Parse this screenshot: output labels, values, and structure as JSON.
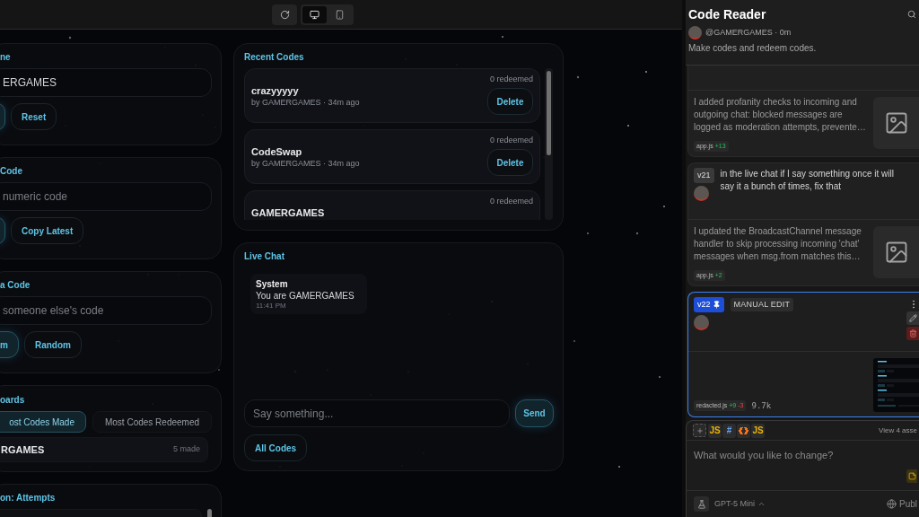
{
  "toolbar": {
    "devices": [
      {
        "kind": "desktop",
        "selected": true
      },
      {
        "kind": "mobile",
        "selected": false
      }
    ]
  },
  "left_cards": [
    {
      "kind": "form",
      "title": "ne",
      "field": {
        "value": "ERGAMES"
      },
      "buttons": [
        {
          "kind": "primary"
        },
        {
          "label": "Reset",
          "kind": "secondary"
        }
      ]
    },
    {
      "kind": "form",
      "title": "Code",
      "field": {
        "placeholder": "numeric code"
      },
      "buttons": [
        {
          "kind": "primary"
        },
        {
          "label": "Copy Latest",
          "kind": "secondary"
        }
      ]
    },
    {
      "kind": "form",
      "title": "a Code",
      "field": {
        "placeholder": "someone else's code"
      },
      "buttons": [
        {
          "label": "m",
          "kind": "primary"
        },
        {
          "label": "Random",
          "kind": "secondary"
        }
      ]
    },
    {
      "kind": "leaderboard",
      "title": "oards",
      "tabs": [
        {
          "label": "ost Codes Made",
          "selected": true
        },
        {
          "label": "Most Codes Redeemed",
          "selected": false
        }
      ],
      "rows": [
        {
          "name": "RGAMES",
          "count": "5 made"
        }
      ]
    },
    {
      "kind": "list",
      "title": "on: Attempts"
    }
  ],
  "recent_codes": {
    "title": "Recent Codes",
    "items": [
      {
        "name": "crazyyyyy",
        "meta": "by GAMERGAMES · 34m ago",
        "redeemed": "0 redeemed",
        "action": "Delete"
      },
      {
        "name": "CodeSwap",
        "meta": "by GAMERGAMES · 34m ago",
        "redeemed": "0 redeemed",
        "action": "Delete"
      },
      {
        "name": "GAMERGAMES",
        "redeemed": "0 redeemed"
      }
    ]
  },
  "live_chat": {
    "title": "Live Chat",
    "messages": [
      {
        "author": "System",
        "text": "You are GAMERGAMES",
        "time": "11:41 PM"
      }
    ],
    "input": {
      "placeholder": "Say something..."
    },
    "send": {
      "label": "Send",
      "kind": "primary"
    },
    "buttons": [
      {
        "label": "All Codes",
        "kind": "secondary"
      }
    ]
  },
  "project": {
    "title": "Code Reader",
    "author": "@GAMERGAMES · 0m",
    "description": "Make codes and redeem codes."
  },
  "versions": [
    {
      "kind": "image",
      "response": "I added profanity checks to incoming and outgoing chat: blocked messages are logged as moderation attempts, prevente…",
      "files": [
        {
          "name": "app.js",
          "added": "+13"
        }
      ],
      "selected": false
    },
    {
      "kind": "image",
      "label": "v21",
      "pinned": false,
      "prompt": "in the live chat if I say something once it will say it a bunch of times, fix that",
      "response": "I updated the BroadcastChannel message handler to skip processing incoming 'chat' messages when msg.from matches this…",
      "files": [
        {
          "name": "app.js",
          "added": "+2"
        }
      ],
      "selected": false
    },
    {
      "kind": "screenshot",
      "label": "v22",
      "pinned": true,
      "tag": "MANUAL EDIT",
      "files": [
        {
          "name": "redacted.js",
          "added": "+9",
          "removed": "-3"
        }
      ],
      "size": "9.7k",
      "selected": true
    }
  ],
  "composer": {
    "chips": [
      {
        "kind": "text",
        "label": "JS",
        "color": "#eab308"
      },
      {
        "kind": "text",
        "label": "#",
        "color": "#60a5fa"
      },
      {
        "kind": "icon",
        "color": "#f97316"
      },
      {
        "kind": "text",
        "label": "JS",
        "color": "#eab308"
      }
    ],
    "assets": "View 4 asse",
    "placeholder": "What would you like to change?",
    "model": "GPT-5 Mini",
    "visibility": "Publ"
  }
}
